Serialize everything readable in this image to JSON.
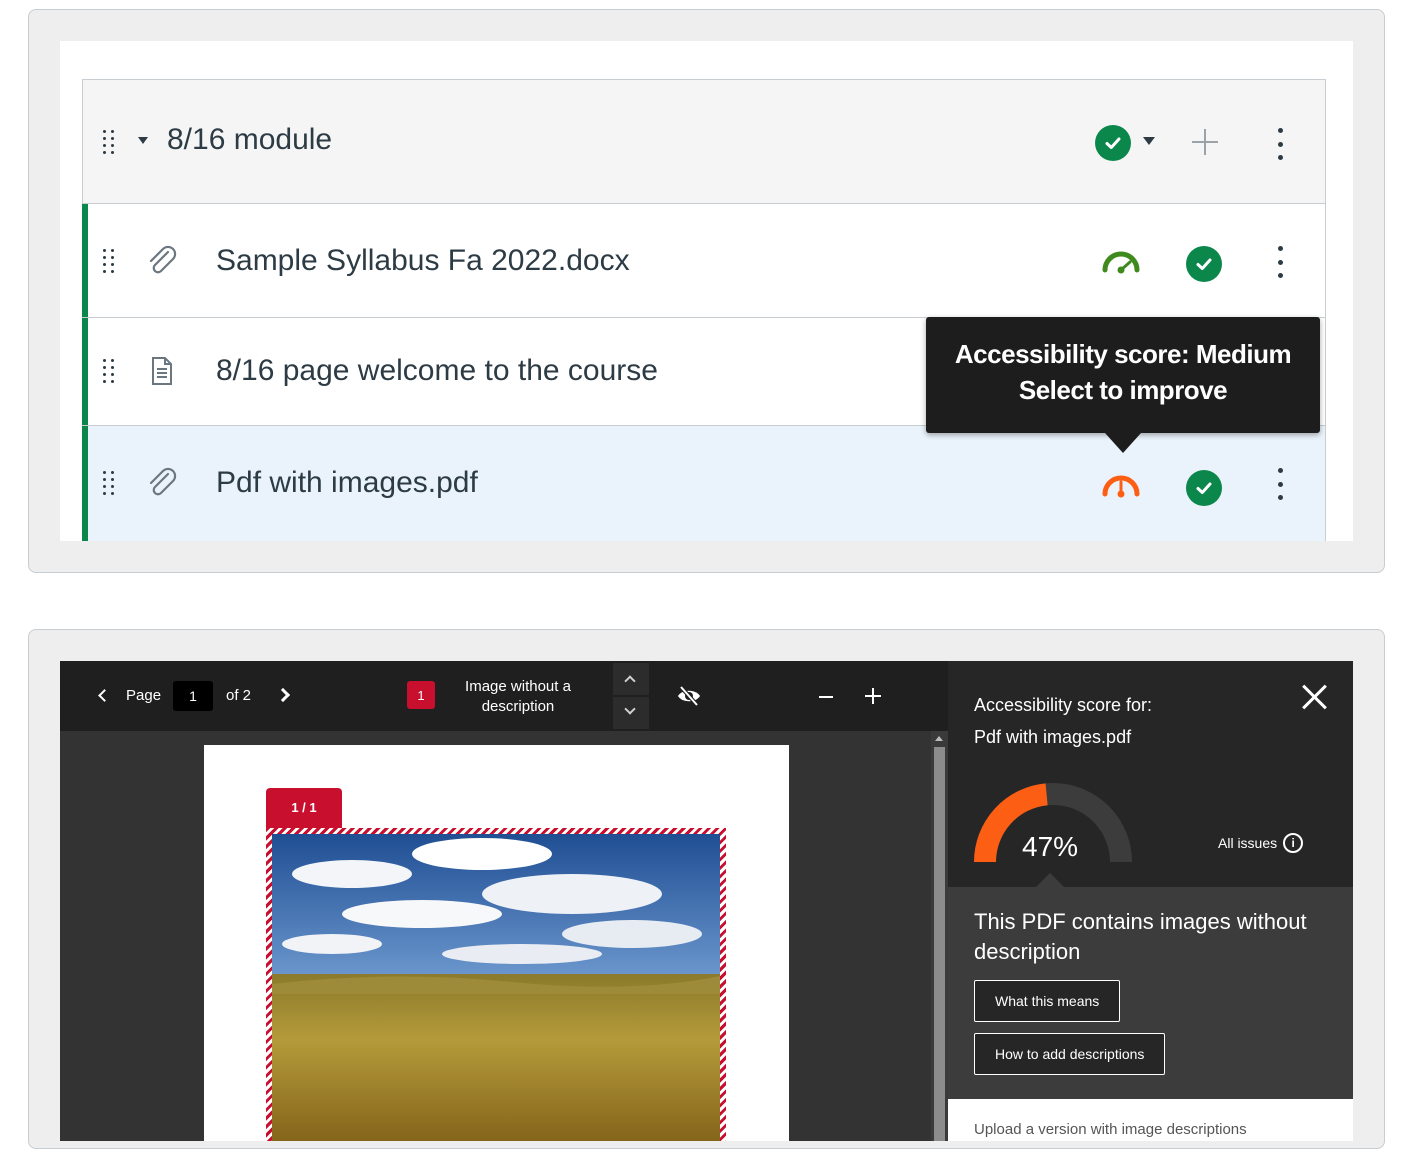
{
  "module": {
    "title": "8/16 module",
    "items": [
      {
        "title": "Sample Syllabus Fa 2022.docx",
        "type": "attachment",
        "accessibility": "high"
      },
      {
        "title": "8/16 page welcome to the course",
        "type": "page"
      },
      {
        "title": "Pdf with images.pdf",
        "type": "attachment",
        "accessibility": "medium"
      }
    ]
  },
  "tooltip": {
    "line1": "Accessibility score: Medium",
    "line2": "Select to improve"
  },
  "viewer": {
    "page_label": "Page",
    "page_current": "1",
    "page_of": "of 2",
    "issue_count": "1",
    "issue_label": "Image without a description",
    "image_tab": "1 / 1"
  },
  "sidebar": {
    "title_line1": "Accessibility score for:",
    "title_line2": "Pdf with images.pdf",
    "score": "47%",
    "score_value": 0.47,
    "all_issues": "All issues",
    "issue_message": "This PDF contains images without description",
    "button_what": "What this means",
    "button_how": "How to add descriptions",
    "upload_text": "Upload a version with image descriptions"
  },
  "colors": {
    "success_green": "#0b874b",
    "medium_orange": "#fc5e13",
    "gauge_green": "#3f8a1e",
    "issue_red": "#c8102e"
  }
}
